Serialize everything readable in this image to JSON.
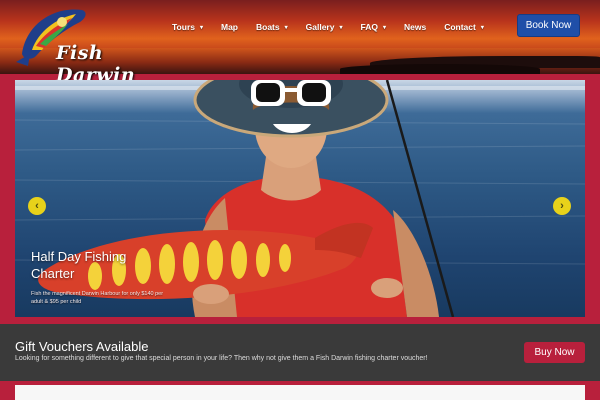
{
  "brand": {
    "name": "Fish Darwin",
    "colors": {
      "primary": "#b8203c",
      "book_button": "#1f4fa8",
      "band": "#3a3a3a",
      "arrow": "#e8d21a"
    }
  },
  "nav": {
    "items": [
      {
        "label": "Tours",
        "has_dropdown": true
      },
      {
        "label": "Map",
        "has_dropdown": false
      },
      {
        "label": "Boats",
        "has_dropdown": true
      },
      {
        "label": "Gallery",
        "has_dropdown": true
      },
      {
        "label": "FAQ",
        "has_dropdown": true
      },
      {
        "label": "News",
        "has_dropdown": false
      },
      {
        "label": "Contact",
        "has_dropdown": true
      }
    ],
    "dropdown_icon": "▾"
  },
  "header": {
    "book_label": "Book Now"
  },
  "slider": {
    "caption_title": "Half Day Fishing Charter",
    "caption_text": "Fish the magnificent Darwin Harbour for only $140 per adult & $95 per child",
    "prev_icon": "‹",
    "next_icon": "›"
  },
  "voucher": {
    "title": "Gift Vouchers Available",
    "text": "Looking for something different to give that special person in your life? Then why not give them a Fish Darwin fishing charter voucher!",
    "button_label": "Buy Now"
  }
}
